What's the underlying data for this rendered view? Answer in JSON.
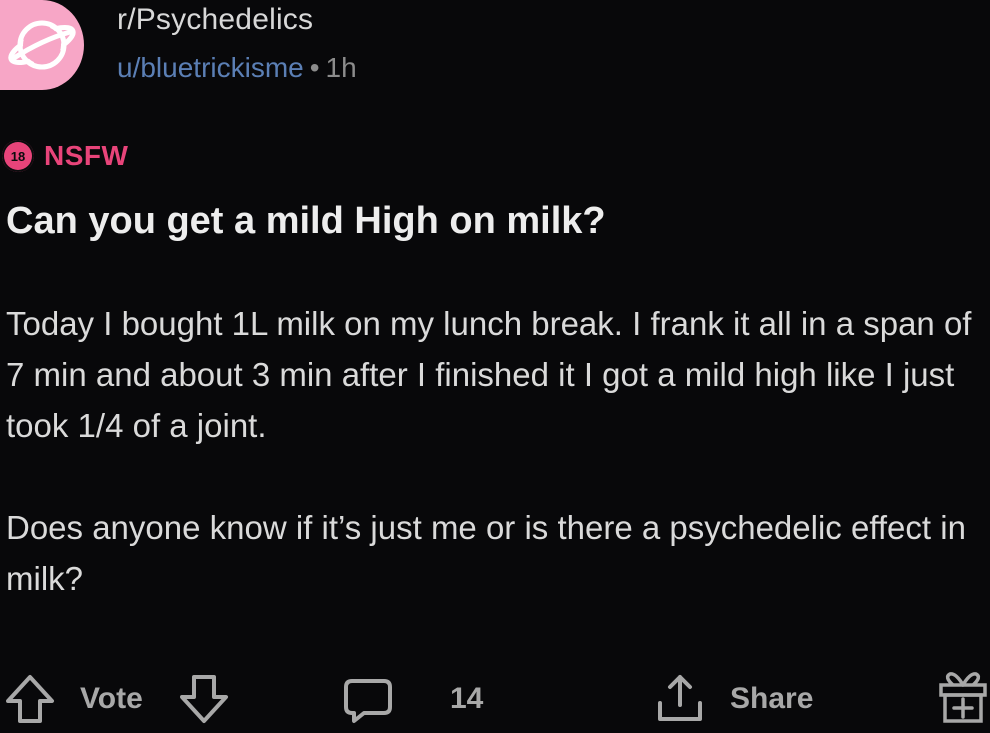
{
  "post": {
    "subreddit": "r/Psychedelics",
    "author": "u/bluetrickisme",
    "separator": "•",
    "age": "1h",
    "nsfw_badge": "18",
    "nsfw_label": "NSFW",
    "title": "Can you get a mild High on milk?",
    "body": [
      "Today I bought 1L milk on my lunch break. I frank it all in a span of 7 min and about 3 min after I finished it I got a mild high like I just took 1/4 of a joint.",
      "Does anyone know if it’s just me or is there a psychedelic effect in milk?"
    ]
  },
  "actions": {
    "vote_label": "Vote",
    "comment_count": "14",
    "share_label": "Share"
  },
  "icons": {
    "avatar": "planet-icon",
    "upvote": "arrow-up-icon",
    "downvote": "arrow-down-icon",
    "comments": "speech-bubble-icon",
    "share": "share-icon",
    "award": "gift-icon"
  },
  "colors": {
    "background": "#08080a",
    "avatar_bg": "#f7a6c6",
    "nsfw": "#e8447a",
    "author_link": "#5b7fb5"
  }
}
